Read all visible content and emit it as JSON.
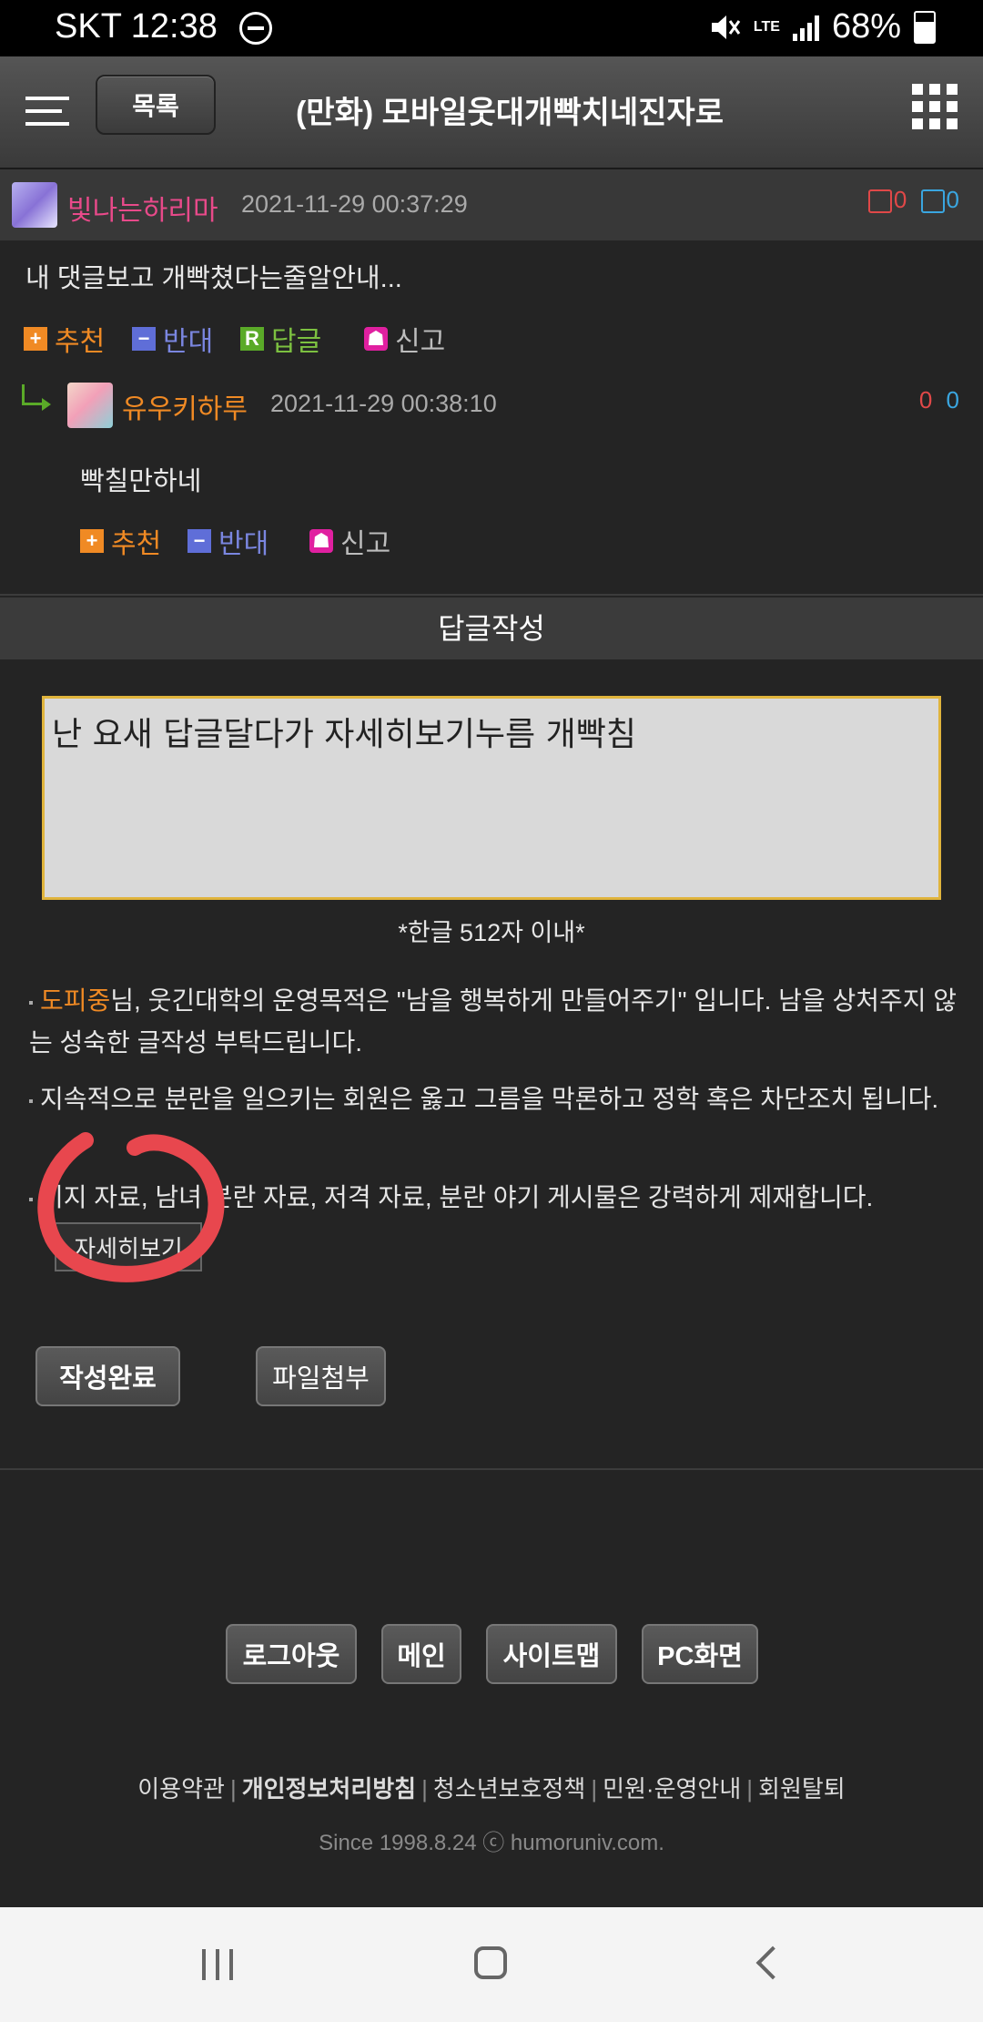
{
  "status_bar": {
    "carrier": "SKT",
    "time": "12:38",
    "network": "LTE",
    "battery": "68%"
  },
  "header": {
    "list_button": "목록",
    "title": "(만화) 모바일웃대개빡치네진자로"
  },
  "comment": {
    "author": "빛나는하리마",
    "date": "2021-11-29 00:37:29",
    "up_votes": "0",
    "down_votes": "0",
    "text": "내 댓글보고 개빡쳤다는줄알안내...",
    "actions": {
      "recommend": "추천",
      "oppose": "반대",
      "reply": "답글",
      "report": "신고"
    },
    "reply": {
      "author": "유우키하루",
      "date": "2021-11-29 00:38:10",
      "up_votes": "0",
      "down_votes": "0",
      "text": "빡칠만하네",
      "actions": {
        "recommend": "추천",
        "oppose": "반대",
        "report": "신고"
      }
    }
  },
  "reply_form": {
    "heading": "답글작성",
    "textarea_value": "난 요새 답글달다가 자세히보기누름 개빡침",
    "limit_note": "*한글 512자 이내*",
    "notice_nick": "도피중",
    "notice_1": "님, 웃긴대학의 운영목적은 \"남을 행복하게 만들어주기\" 입니다. 남을 상처주지 않는 성숙한 글작성 부탁드립니다.",
    "notice_2": "지속적으로 분란을 일으키는 회원은 옳고 그름을 막론하고 정학 혹은 차단조치 됩니다.",
    "notice_3": "이지 자료, 남녀 분란 자료, 저격 자료, 분란 야기 게시물은 강력하게 제재합니다.",
    "detail_button": "자세히보기",
    "submit_button": "작성완료",
    "attach_button": "파일첨부"
  },
  "footer": {
    "buttons": {
      "logout": "로그아웃",
      "main": "메인",
      "sitemap": "사이트맵",
      "pc": "PC화면"
    },
    "links": {
      "terms": "이용약관",
      "privacy": "개인정보처리방침",
      "youth": "청소년보호정책",
      "support": "민원·운영안내",
      "withdraw": "회원탈퇴"
    },
    "since": "Since 1998.8.24 ⓒ humoruniv.com."
  },
  "colors": {
    "nickname_orange": "#f08a24",
    "author_pink": "#e84a8a",
    "annotation_red": "#e8474e"
  }
}
